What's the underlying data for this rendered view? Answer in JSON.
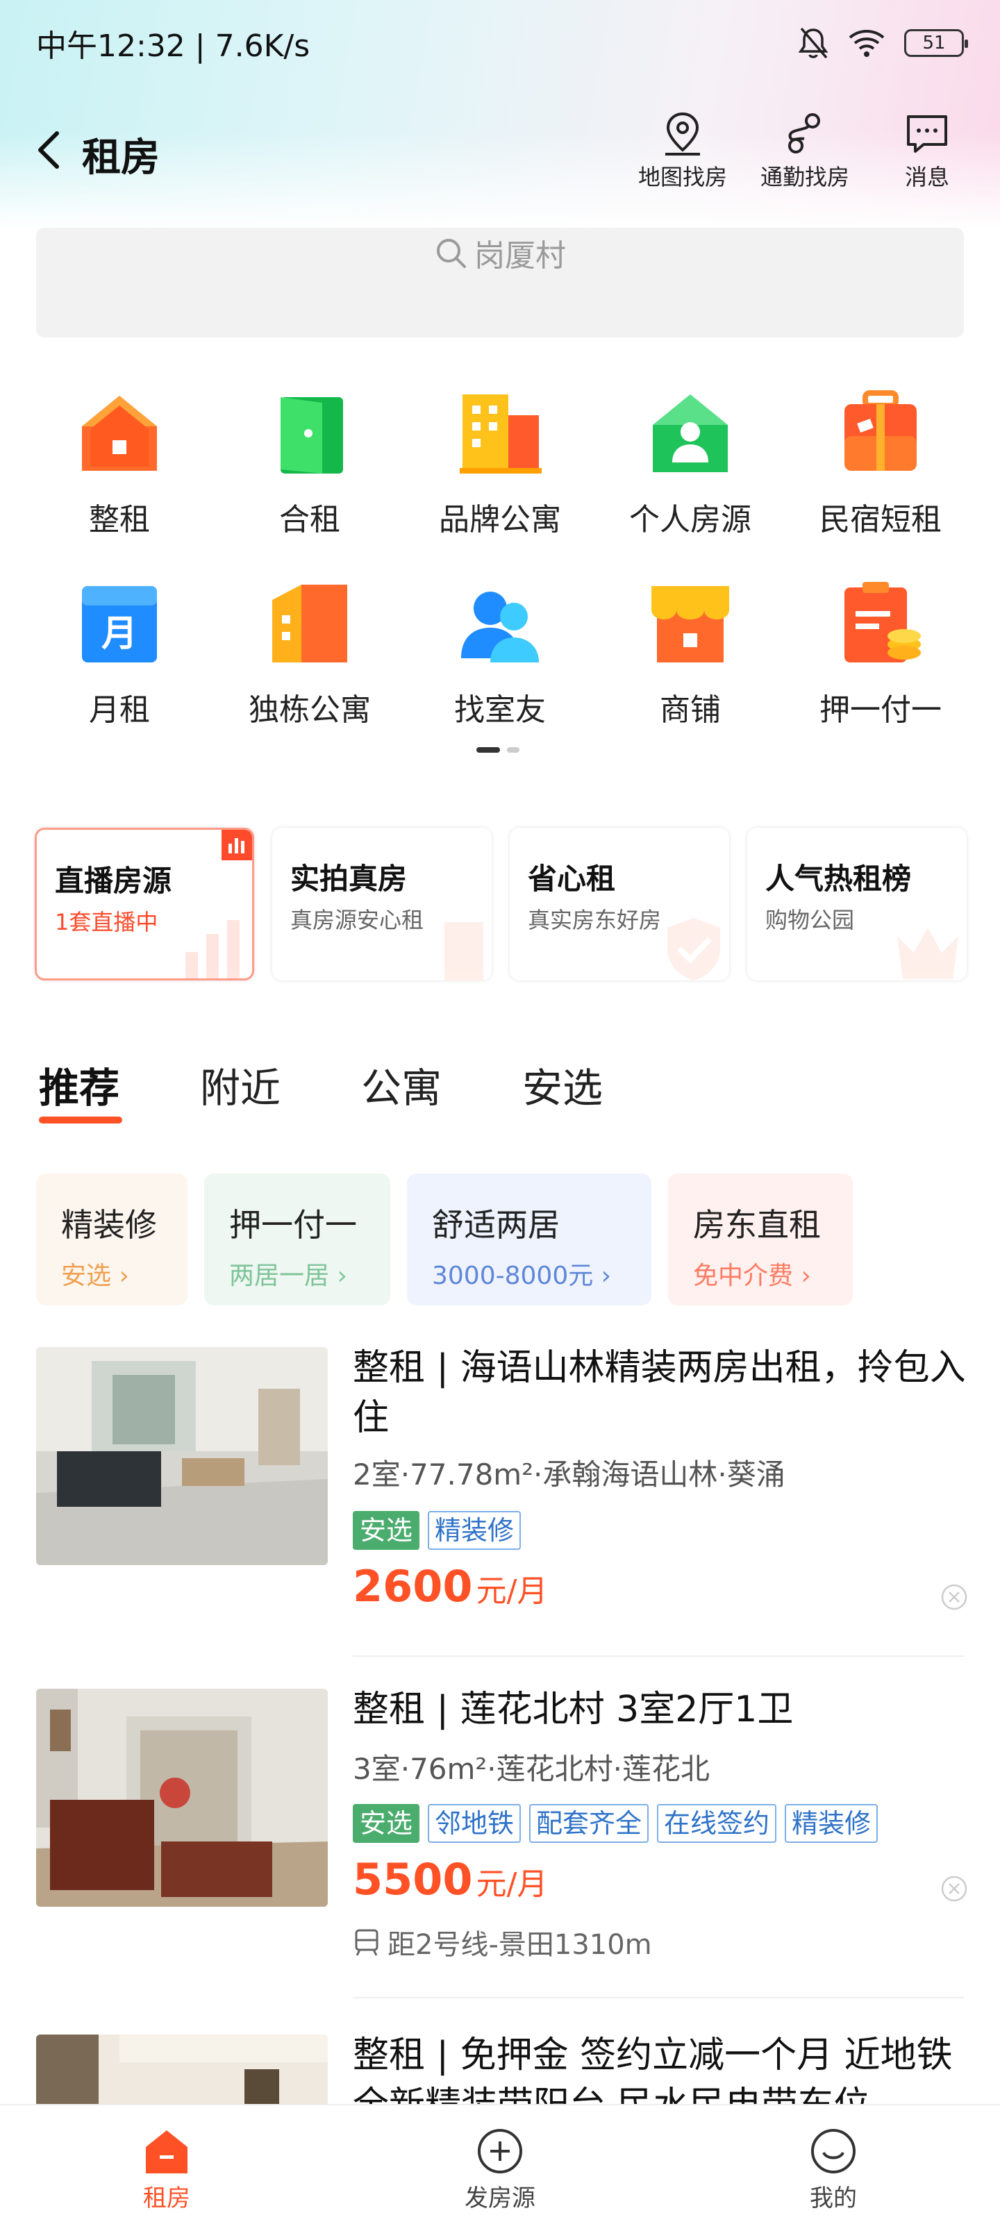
{
  "status_bar": {
    "time_speed": "中午12:32 | 7.6K/s",
    "battery": "51"
  },
  "nav": {
    "title": "租房",
    "actions": [
      {
        "label": "地图找房",
        "icon": "map-pin-icon"
      },
      {
        "label": "通勤找房",
        "icon": "route-icon"
      },
      {
        "label": "消息",
        "icon": "message-icon"
      }
    ]
  },
  "search": {
    "placeholder": "岗厦村"
  },
  "categories": [
    {
      "label": "整租",
      "icon": "house-icon"
    },
    {
      "label": "合租",
      "icon": "door-icon"
    },
    {
      "label": "品牌公寓",
      "icon": "building-icon"
    },
    {
      "label": "个人房源",
      "icon": "person-house-icon"
    },
    {
      "label": "民宿短租",
      "icon": "luggage-icon"
    },
    {
      "label": "月租",
      "icon": "calendar-icon"
    },
    {
      "label": "独栋公寓",
      "icon": "apartment-icon"
    },
    {
      "label": "找室友",
      "icon": "roommate-icon"
    },
    {
      "label": "商铺",
      "icon": "shop-icon"
    },
    {
      "label": "押一付一",
      "icon": "deposit-icon"
    }
  ],
  "feature_cards": [
    {
      "title": "直播房源",
      "subtitle": "1套直播中"
    },
    {
      "title": "实拍真房",
      "subtitle": "真房源安心租"
    },
    {
      "title": "省心租",
      "subtitle": "真实房东好房"
    },
    {
      "title": "人气热租榜",
      "subtitle": "购物公园"
    }
  ],
  "tabs": [
    "推荐",
    "附近",
    "公寓",
    "安选"
  ],
  "chips": [
    {
      "title": "精装修",
      "subtitle": "安选 ›",
      "bg": "#fdf6ef",
      "color": "#f0a050"
    },
    {
      "title": "押一付一",
      "subtitle": "两居一居 ›",
      "bg": "#eef7f1",
      "color": "#7ec49a"
    },
    {
      "title": "舒适两居",
      "subtitle": "3000-8000元 ›",
      "bg": "#eef3fd",
      "color": "#5f86d9"
    },
    {
      "title": "房东直租",
      "subtitle": "免中介费 ›",
      "bg": "#fff1ef",
      "color": "#ff7b63"
    }
  ],
  "listings": [
    {
      "title": "整租 | 海语山林精装两房出租，拎包入住",
      "meta": "2室·77.78m²·承翰海语山林·葵涌",
      "tags": [
        "安选",
        "精装修"
      ],
      "price": "2600",
      "unit": "元/月",
      "extra": ""
    },
    {
      "title": "整租 | 莲花北村 3室2厅1卫",
      "meta": "3室·76m²·莲花北村·莲花北",
      "tags": [
        "安选",
        "邻地铁",
        "配套齐全",
        "在线签约",
        "精装修"
      ],
      "price": "5500",
      "unit": "元/月",
      "extra": "距2号线-景田1310m"
    },
    {
      "title": "整租 | 免押金 签约立减一个月 近地铁全新精装带阳台 民水民电带东位",
      "meta": "",
      "tags": [],
      "price": "",
      "unit": "",
      "extra": ""
    }
  ],
  "bottom_nav": [
    {
      "label": "租房",
      "icon": "house-tab-icon"
    },
    {
      "label": "发房源",
      "icon": "plus-circle-icon"
    },
    {
      "label": "我的",
      "icon": "smile-icon"
    }
  ],
  "colors": {
    "accent": "#ff5126",
    "tag_green": "#4aac6d",
    "tag_blue": "#2f73c9"
  }
}
